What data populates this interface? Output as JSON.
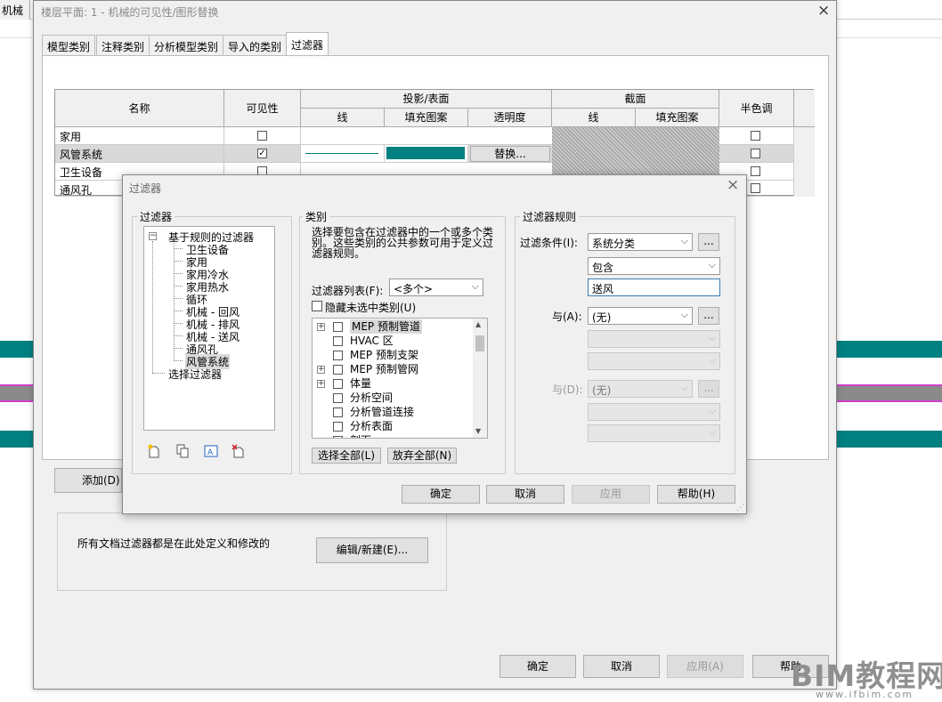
{
  "background_app": {
    "tab_label": "机械"
  },
  "main_dialog": {
    "title": "楼层平面: 1 - 机械的可见性/图形替换",
    "close_icon": "×",
    "tabs": [
      "模型类别",
      "注释类别",
      "分析模型类别",
      "导入的类别",
      "过滤器"
    ],
    "active_tab": "过滤器",
    "table": {
      "headers": {
        "name": "名称",
        "visibility": "可见性",
        "projection": "投影/表面",
        "line": "线",
        "fill": "填充图案",
        "transparency": "透明度",
        "cut": "截面",
        "cut_line": "线",
        "cut_fill": "填充图案",
        "halftone": "半色调"
      },
      "rows": [
        {
          "name": "家用",
          "visible": false,
          "halftone": false
        },
        {
          "name": "风管系统",
          "visible": true,
          "halftone": false,
          "override_label": "替换..."
        },
        {
          "name": "卫生设备",
          "visible": false,
          "halftone": false
        },
        {
          "name": "通风孔",
          "visible": false,
          "halftone": false
        }
      ],
      "line_color": "#007b7b",
      "fill_color": "#008080"
    },
    "add_button": "添加(D)",
    "info_text": "所有文档过滤器都是在此处定义和修改的",
    "edit_button": "编辑/新建(E)...",
    "ok_button": "确定",
    "cancel_button": "取消",
    "apply_button": "应用(A)",
    "help_button": "帮助"
  },
  "filter_dialog": {
    "title": "过滤器",
    "close_icon": "×",
    "filters_group": "过滤器",
    "tree_root": "基于规则的过滤器",
    "tree_children": [
      "卫生设备",
      "家用",
      "家用冷水",
      "家用热水",
      "循环",
      "机械 - 回风",
      "机械 - 排风",
      "机械 - 送风",
      "通风孔",
      "风管系统"
    ],
    "tree_selected": "风管系统",
    "tree_selection_filter": "选择过滤器",
    "categories_group": "类别",
    "categories_desc": "选择要包含在过滤器中的一个或多个类别。这些类别的公共参数可用于定义过滤器规则。",
    "filter_list_label": "过滤器列表(F):",
    "filter_list_value": "<多个>",
    "hide_unchecked_label": "隐藏未选中类别(U)",
    "category_items": [
      {
        "label": "MEP 预制管道",
        "expandable": true
      },
      {
        "label": "HVAC 区",
        "expandable": false
      },
      {
        "label": "MEP 预制支架",
        "expandable": false
      },
      {
        "label": "MEP 预制管网",
        "expandable": true
      },
      {
        "label": "体量",
        "expandable": true
      },
      {
        "label": "分析空间",
        "expandable": false
      },
      {
        "label": "分析管道连接",
        "expandable": false
      },
      {
        "label": "分析表面",
        "expandable": false
      },
      {
        "label": "剖面",
        "expandable": false
      }
    ],
    "select_all_button": "选择全部(L)",
    "deselect_all_button": "放弃全部(N)",
    "rules_group": "过滤器规则",
    "filter_by_label": "过滤条件(I):",
    "filter_by_value": "系统分类",
    "operator_value": "包含",
    "rule_value": "送风",
    "and1_label": "与(A):",
    "and1_value": "(无)",
    "and2_label": "与(D):",
    "and2_value": "(无)",
    "more_button": "...",
    "ok_button": "确定",
    "cancel_button": "取消",
    "apply_button": "应用",
    "help_button": "帮助(H)"
  },
  "watermark": {
    "title": "BIM教程网",
    "url": "www.ifbim.com"
  },
  "colors": {
    "teal_band": "#008080",
    "gray_band": "#8a8a8a",
    "magenta_line": "#d040d0",
    "selection": "#d9d9d9"
  }
}
